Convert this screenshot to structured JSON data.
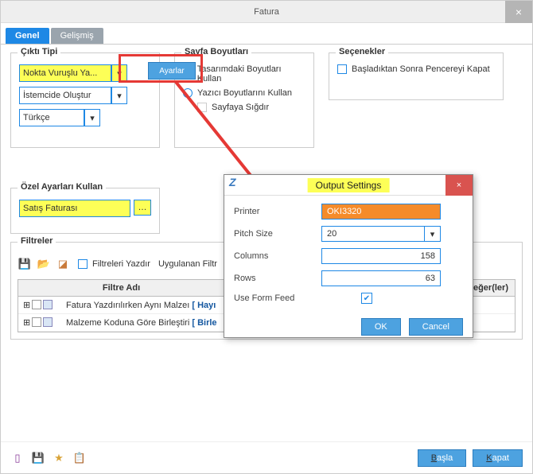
{
  "window": {
    "title": "Fatura",
    "close": "×"
  },
  "tabs": {
    "active": "Genel",
    "other": "Gelişmiş"
  },
  "cikti": {
    "legend": "Çıktı Tipi",
    "sel1": "Nokta Vuruşlu Ya...",
    "sel2": "İstemcide Oluştur",
    "sel3": "Türkçe"
  },
  "ayarlar_btn": "Ayarlar",
  "sayfa": {
    "legend": "Sayfa Boyutları",
    "r1": "Tasarımdaki Boyutları Kullan",
    "r2": "Yazıcı Boyutlarını Kullan",
    "c1": "Sayfaya Sığdır"
  },
  "secenek": {
    "legend": "Seçenekler",
    "c1": "Başladıktan Sonra Pencereyi Kapat"
  },
  "ozel": {
    "legend": "Özel Ayarları Kullan",
    "val": "Satış Faturası"
  },
  "filt": {
    "legend": "Filtreler",
    "chk": "Filtreleri Yazdır",
    "uyg": "Uygulanan Filtr",
    "col_ad": "Filtre Adı",
    "col_deg": "eğer(ler)",
    "r1": "Fatura Yazdırılırken Aynı Malzeı",
    "r1b": "[ Hayı",
    "r2": "Malzeme Koduna Göre Birleştiri",
    "r2b": "[ Birle"
  },
  "footer": {
    "basla": "Başla",
    "kapat": "Kapat"
  },
  "dialog": {
    "title": "Output Settings",
    "printer_l": "Printer",
    "printer_v": "OKI3320",
    "pitch_l": "Pitch Size",
    "pitch_v": "20",
    "cols_l": "Columns",
    "cols_v": "158",
    "rows_l": "Rows",
    "rows_v": "63",
    "uff_l": "Use Form Feed",
    "ok": "OK",
    "cancel": "Cancel",
    "close": "×"
  }
}
